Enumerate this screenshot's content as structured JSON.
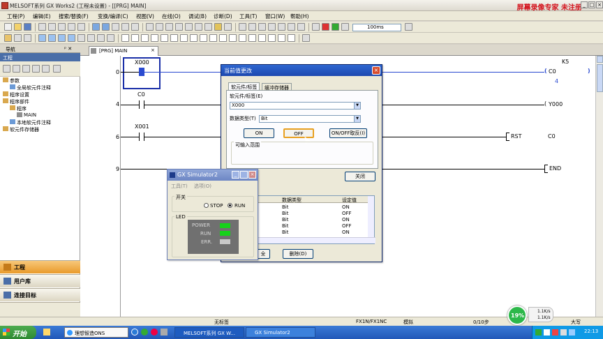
{
  "window": {
    "title": "MELSOFT系列 GX Works2 (工程未设置) - [[PRG] MAIN]",
    "watermark": "屏幕录像专家 未注册"
  },
  "menu": [
    "工程(P)",
    "编辑(E)",
    "搜索/替换(F)",
    "变换/编译(C)",
    "视图(V)",
    "在线(O)",
    "调试(B)",
    "诊断(D)",
    "工具(T)",
    "窗口(W)",
    "帮助(H)"
  ],
  "toolbar": {
    "scan_time": "100ms"
  },
  "navigation": {
    "header": "导航",
    "pin": "ᵖ ✕",
    "subheader": "工程",
    "tree": [
      {
        "label": "参数",
        "indent": 0
      },
      {
        "label": "全局软元件注释",
        "indent": 1
      },
      {
        "label": "程序设置",
        "indent": 0
      },
      {
        "label": "程序部件",
        "indent": 0
      },
      {
        "label": "程序",
        "indent": 1
      },
      {
        "label": "MAIN",
        "indent": 2
      },
      {
        "label": "本地软元件注释",
        "indent": 1
      },
      {
        "label": "软元件存储器",
        "indent": 0
      }
    ],
    "buttons": [
      "工程",
      "用户库",
      "连接目标"
    ]
  },
  "editor": {
    "tab_label": "[PRG] MAIN",
    "step_numbers": [
      "0",
      "4",
      "6",
      "9"
    ],
    "contacts": [
      "X000",
      "C0",
      "X001"
    ],
    "coil_c0": "C0",
    "coil_c0_const": "K5",
    "coil_c0_value": "4",
    "coil_y000": "Y000",
    "rst_instruction": "RST",
    "rst_operand": "C0",
    "end_instruction": "END"
  },
  "dialog_modify": {
    "title": "当前值更改",
    "tabs": [
      "软元件/标签",
      "缓冲存储器"
    ],
    "device_label": "软元件/标签(E)",
    "device_value": "X000",
    "datatype_label": "数据类型(T)",
    "datatype_value": "Bit",
    "btn_on": "ON",
    "btn_off": "OFF",
    "btn_toggle": "ON/OFF取反(I)",
    "range_label": "可输入范围",
    "btn_close": "关闭",
    "btn_delete": "删除(D)",
    "btn_partial_left": "全",
    "history_headers": [
      "数据类型",
      "设定值"
    ],
    "history_rows": [
      {
        "type": "Bit",
        "value": "ON"
      },
      {
        "type": "Bit",
        "value": "OFF"
      },
      {
        "type": "Bit",
        "value": "ON"
      },
      {
        "type": "Bit",
        "value": "OFF"
      },
      {
        "type": "Bit",
        "value": "ON"
      }
    ]
  },
  "dialog_sim": {
    "title": "GX Simulator2",
    "menu": [
      "工具(T)",
      "选项(O)"
    ],
    "switch_group": "开关",
    "stop_label": "STOP",
    "run_label": "RUN",
    "switch_state": "RUN",
    "led_group": "LED",
    "leds": [
      {
        "label": "POWER",
        "color": "#16d21a"
      },
      {
        "label": "RUN",
        "color": "#16d21a"
      },
      {
        "label": "ERR.",
        "color": "#c8c8c8"
      }
    ]
  },
  "statusbar": {
    "label": "无标签",
    "cpu": "FX1N/FX1NC",
    "mode": "模拟",
    "steps": "0/10步",
    "caps": "大写"
  },
  "taskbar": {
    "start": "开始",
    "tasks": [
      "理想智造ONS",
      "MELSOFT系列 GX W...",
      "GX Simulator2"
    ],
    "cpu_percent": "19%",
    "net_up": "1.1K/s",
    "net_down": "1.1K/s",
    "clock": "22:13"
  }
}
